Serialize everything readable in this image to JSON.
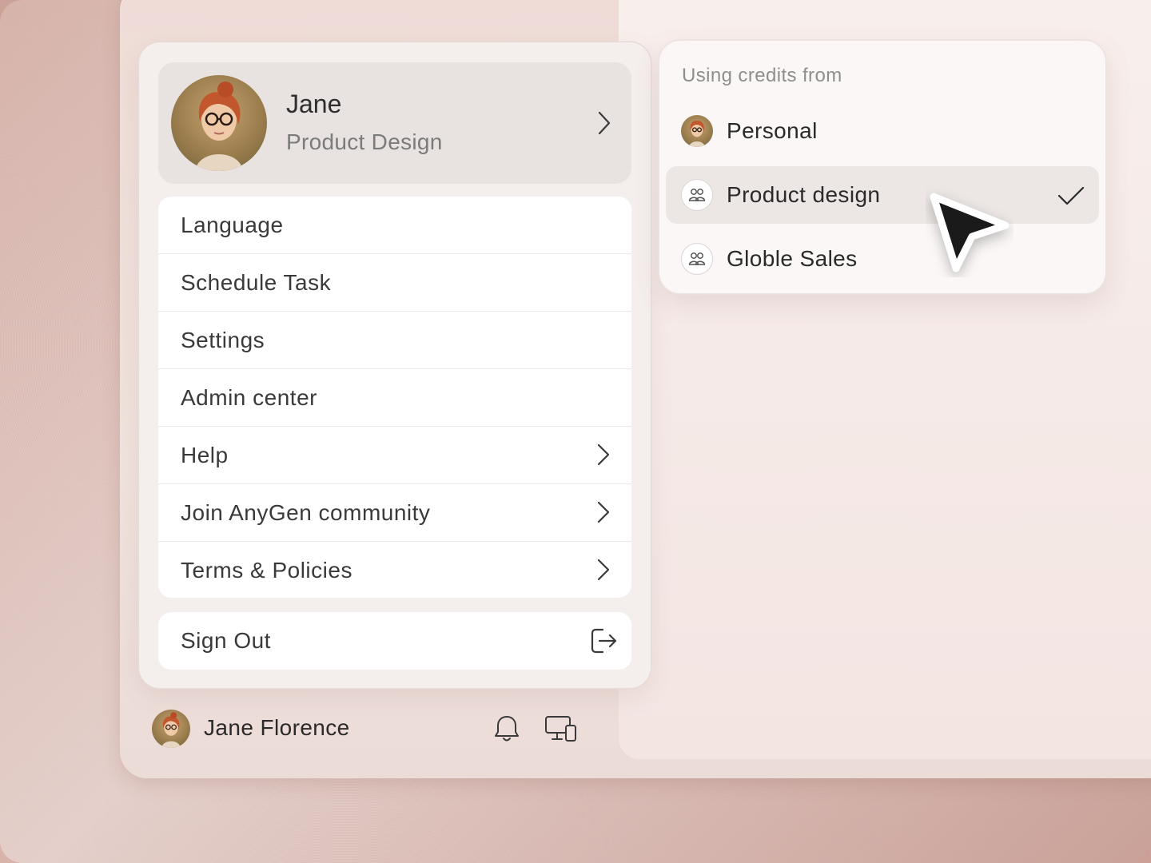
{
  "profile": {
    "name": "Jane",
    "role": "Product Design"
  },
  "menu": {
    "items": [
      {
        "label": "Language",
        "has_submenu": false
      },
      {
        "label": "Schedule Task",
        "has_submenu": false
      },
      {
        "label": "Settings",
        "has_submenu": false
      },
      {
        "label": "Admin center",
        "has_submenu": false
      },
      {
        "label": "Help",
        "has_submenu": true
      },
      {
        "label": "Join AnyGen community",
        "has_submenu": true
      },
      {
        "label": "Terms & Policies",
        "has_submenu": true
      }
    ],
    "sign_out": "Sign Out"
  },
  "footer": {
    "user_name": "Jane Florence",
    "icons": [
      "bell-icon",
      "devices-icon"
    ]
  },
  "credits": {
    "heading": "Using credits from",
    "options": [
      {
        "label": "Personal",
        "icon": "avatar",
        "selected": false
      },
      {
        "label": "Product design",
        "icon": "group-icon",
        "selected": true
      },
      {
        "label": "Globle Sales",
        "icon": "group-icon",
        "selected": false
      }
    ]
  },
  "colors": {
    "accent_text": "#2a2a2a",
    "muted_text": "#7b7b7b",
    "selected_row": "#ece7e5",
    "cursor": "#1a1a1a"
  }
}
